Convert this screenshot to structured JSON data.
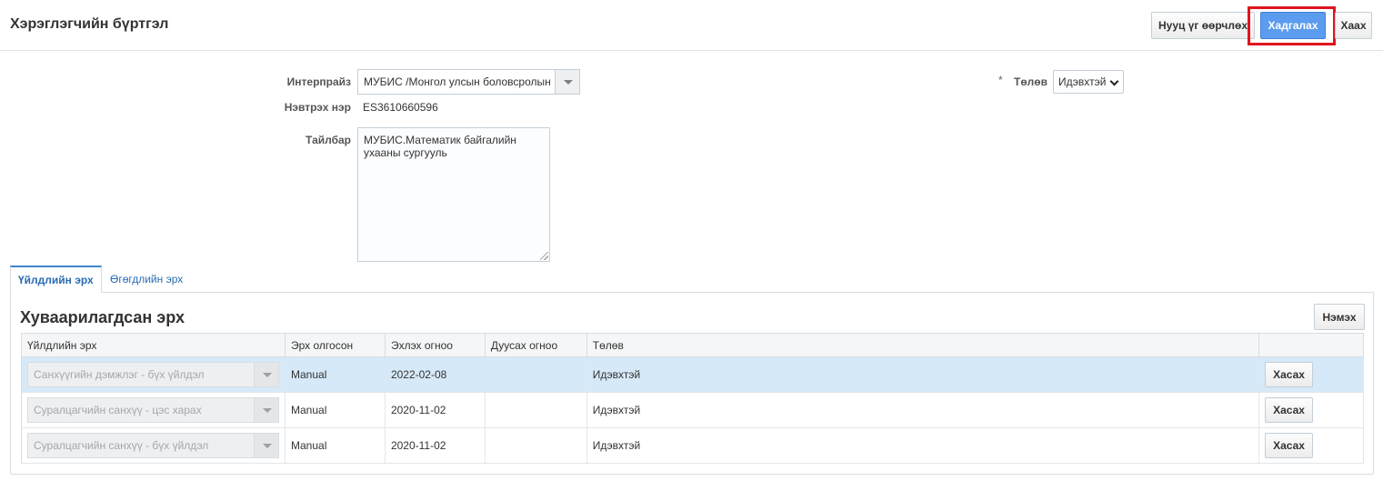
{
  "header": {
    "title": "Хэрэглэгчийн бүртгэл",
    "buttons": {
      "change_password": "Нууц үг өөрчлөх",
      "save": "Хадгалах",
      "close": "Хаах"
    }
  },
  "form": {
    "enterprise_label": "Интерпрайз",
    "enterprise_value": "МУБИС /Монгол улсын боловсролын",
    "username_label": "Нэвтрэх нэр",
    "username_value": "ES3610660596",
    "description_label": "Тайлбар",
    "description_value": "МУБИС.Математик байгалийн ухааны сургууль",
    "status_required_mark": "*",
    "status_label": "Төлөв",
    "status_value": "Идэвхтэй"
  },
  "tabs": [
    {
      "label": "Үйлдлийн эрх",
      "active": true
    },
    {
      "label": "Өгөгдлийн эрх",
      "active": false
    }
  ],
  "section": {
    "title": "Хуваарилагдсан эрх",
    "add_button": "Нэмэх"
  },
  "table": {
    "columns": [
      "Үйлдлийн эрх",
      "Эрх олгосон",
      "Эхлэх огноо",
      "Дуусах огноо",
      "Төлөв",
      ""
    ],
    "rows": [
      {
        "permission": "Санхүүгийн дэмжлэг - бүх үйлдэл",
        "granted": "Manual",
        "start": "2022-02-08",
        "end": "",
        "status": "Идэвхтэй",
        "action": "Хасах",
        "selected": true
      },
      {
        "permission": "Суралцагчийн санхүү - цэс харах",
        "granted": "Manual",
        "start": "2020-11-02",
        "end": "",
        "status": "Идэвхтэй",
        "action": "Хасах",
        "selected": false
      },
      {
        "permission": "Суралцагчийн санхүү - бүх үйлдэл",
        "granted": "Manual",
        "start": "2020-11-02",
        "end": "",
        "status": "Идэвхтэй",
        "action": "Хасах",
        "selected": false
      }
    ]
  },
  "colors": {
    "primary_button": "#5c9cee",
    "highlight": "#e0141e",
    "selected_row": "#d6e9f8",
    "tab_accent": "#4285c7"
  }
}
